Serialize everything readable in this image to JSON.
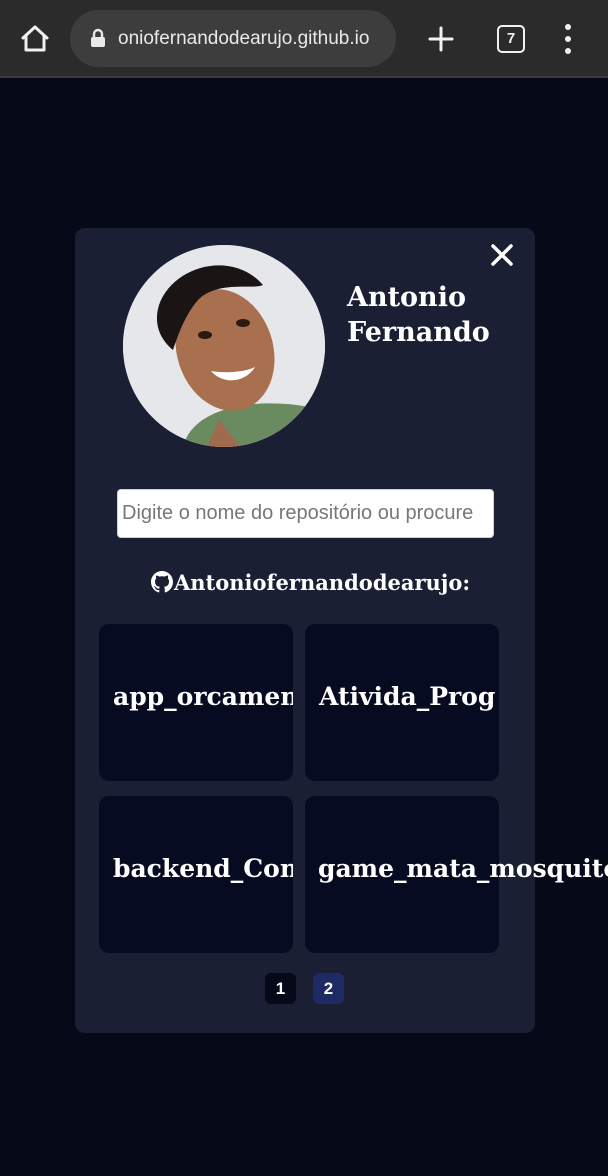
{
  "browser": {
    "url": "oniofernandodearujo.github.io",
    "tab_count": "7"
  },
  "profile": {
    "name": "Antonio Fernando"
  },
  "search": {
    "placeholder": "Digite o nome do repositório ou procure"
  },
  "github": {
    "heading": "Antoniofernandodearujo:"
  },
  "repos": [
    {
      "title": "app_orcamento"
    },
    {
      "title": "Ativida_Prog"
    },
    {
      "title": "backend_Contr"
    },
    {
      "title": "game_mata_mosquito"
    }
  ],
  "pagination": [
    "1",
    "2"
  ],
  "colors": {
    "page_bg": "#060917",
    "card_bg": "#1b1f34",
    "repo_bg": "#070b22",
    "active_page": "#1e2a63"
  }
}
